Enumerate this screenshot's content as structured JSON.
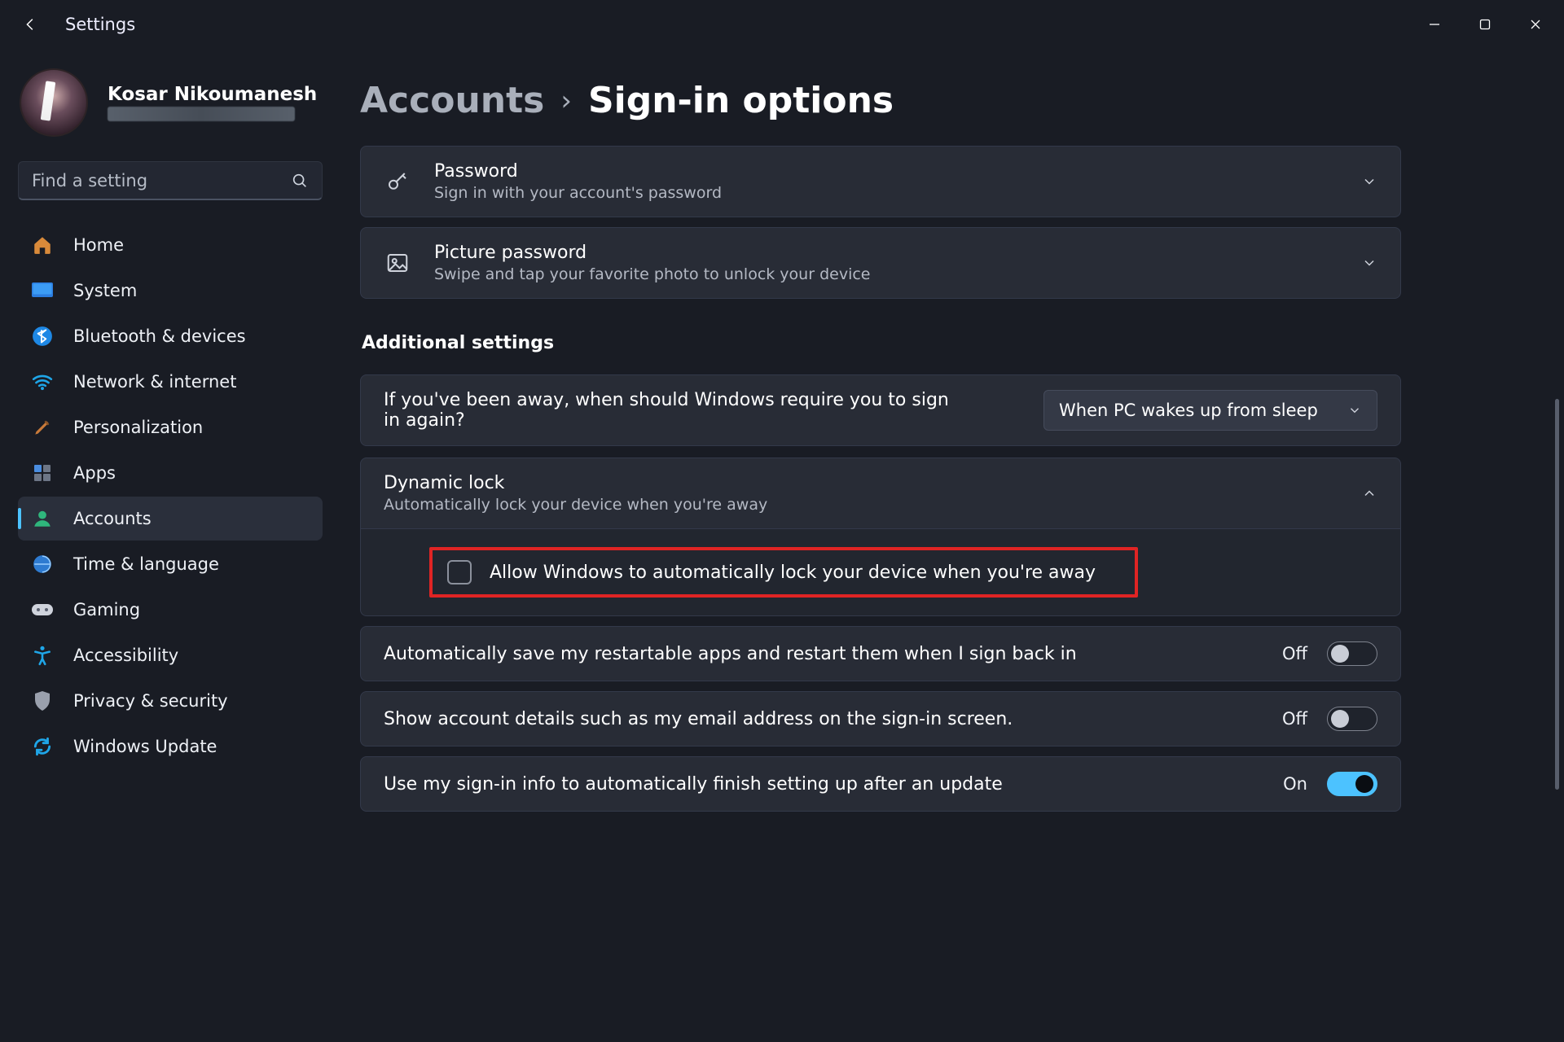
{
  "titlebar": {
    "app_title": "Settings"
  },
  "profile": {
    "display_name": "Kosar Nikoumanesh"
  },
  "search": {
    "placeholder": "Find a setting"
  },
  "sidebar": {
    "items": [
      {
        "label": "Home"
      },
      {
        "label": "System"
      },
      {
        "label": "Bluetooth & devices"
      },
      {
        "label": "Network & internet"
      },
      {
        "label": "Personalization"
      },
      {
        "label": "Apps"
      },
      {
        "label": "Accounts"
      },
      {
        "label": "Time & language"
      },
      {
        "label": "Gaming"
      },
      {
        "label": "Accessibility"
      },
      {
        "label": "Privacy & security"
      },
      {
        "label": "Windows Update"
      }
    ],
    "active_index": 6
  },
  "breadcrumb": {
    "parent": "Accounts",
    "current": "Sign-in options",
    "separator": "›"
  },
  "signin_methods": [
    {
      "title": "Password",
      "subtitle": "Sign in with your account's password"
    },
    {
      "title": "Picture password",
      "subtitle": "Swipe and tap your favorite photo to unlock your device"
    }
  ],
  "additional": {
    "heading": "Additional settings",
    "away_prompt": "If you've been away, when should Windows require you to sign in again?",
    "away_value": "When PC wakes up from sleep",
    "dynamic_lock": {
      "title": "Dynamic lock",
      "subtitle": "Automatically lock your device when you're away",
      "checkbox_label": "Allow Windows to automatically lock your device when you're away",
      "checked": false
    },
    "toggles": [
      {
        "label": "Automatically save my restartable apps and restart them when I sign back in",
        "state_text": "Off",
        "on": false
      },
      {
        "label": "Show account details such as my email address on the sign-in screen.",
        "state_text": "Off",
        "on": false
      },
      {
        "label": "Use my sign-in info to automatically finish setting up after an update",
        "state_text": "On",
        "on": true
      }
    ]
  }
}
